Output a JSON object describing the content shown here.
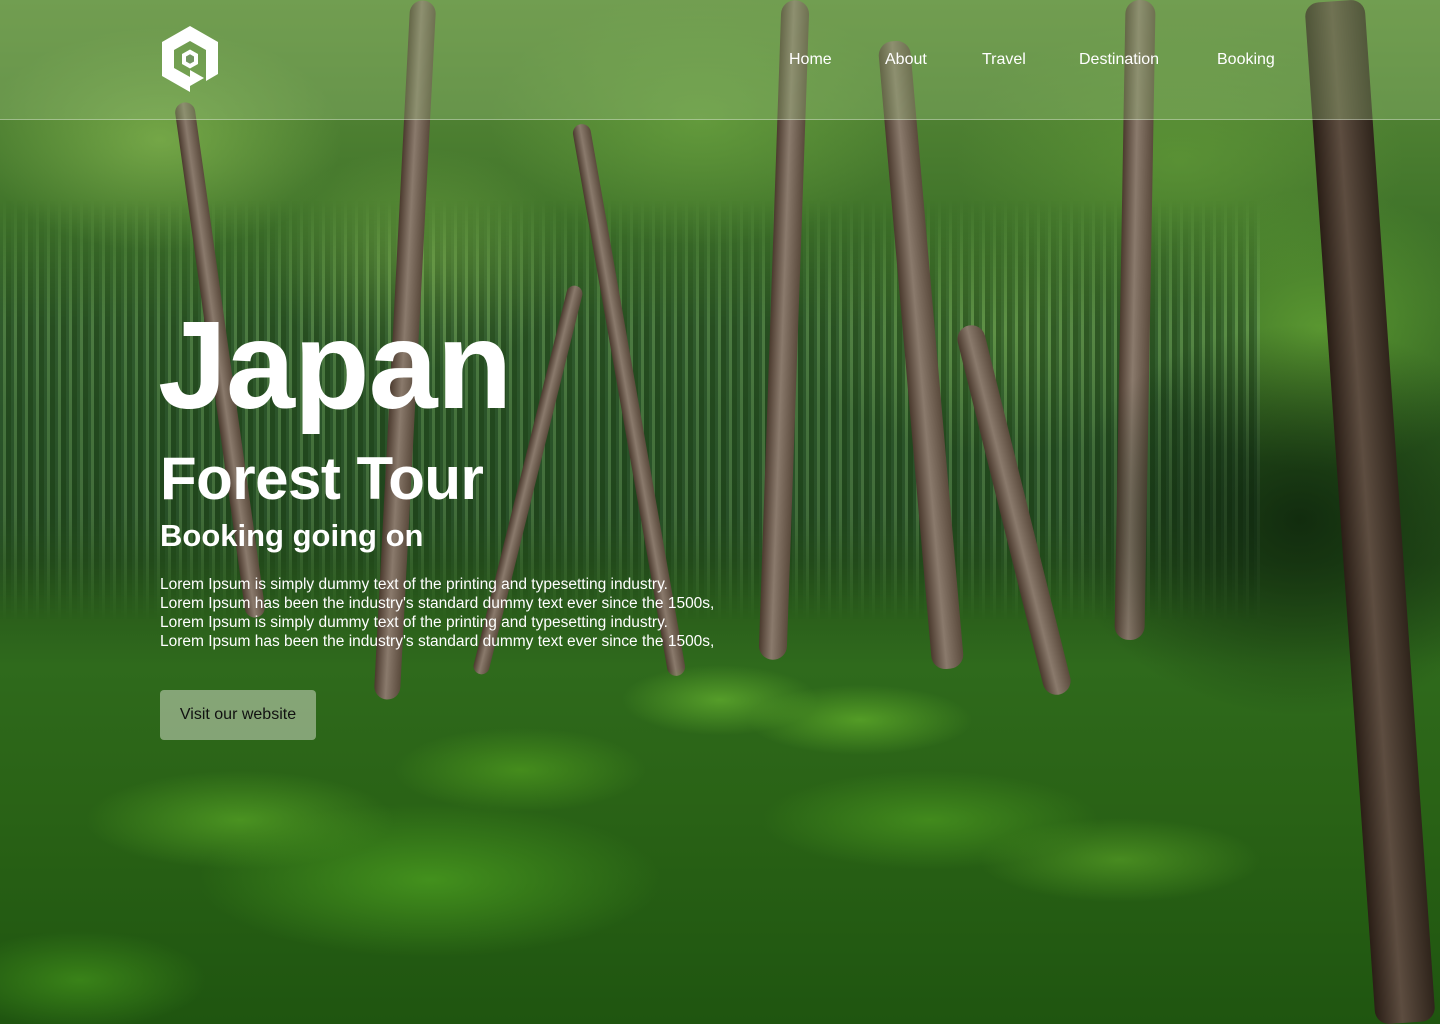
{
  "brand": {
    "logo_icon": "hexagon-p-logo-icon"
  },
  "nav": {
    "items": [
      {
        "label": "Home"
      },
      {
        "label": "About"
      },
      {
        "label": "Travel"
      },
      {
        "label": "Destination"
      },
      {
        "label": "Booking"
      }
    ]
  },
  "hero": {
    "title": "Japan",
    "subtitle": "Forest Tour",
    "tagline": "Booking going on",
    "body_lines": [
      "Lorem Ipsum is simply dummy text of the printing and typesetting industry.",
      "Lorem Ipsum has been the industry's standard dummy text ever since the 1500s,",
      "Lorem Ipsum is simply dummy text of the printing and typesetting industry.",
      "Lorem Ipsum has been the industry's standard dummy text ever since the 1500s,"
    ],
    "cta_label": "Visit our website",
    "background": "forest-moss-photo"
  },
  "colors": {
    "text": "#ffffff",
    "header_overlay": "#96b978",
    "button_bg": "#cdd7c3",
    "button_text": "#111111"
  }
}
